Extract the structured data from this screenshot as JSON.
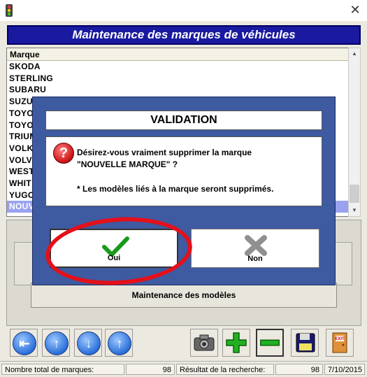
{
  "window": {
    "close_glyph": "✕"
  },
  "header": {
    "title": "Maintenance des marques de véhicules"
  },
  "list": {
    "column_header": "Marque",
    "rows": [
      "SKODA",
      "STERLING",
      "SUBARU",
      "SUZU",
      "TOYO",
      "TOYO",
      "TRIUM",
      "VOLK",
      "VOLV",
      "WEST",
      "WHIT",
      "YUGO",
      "NOUV"
    ],
    "selected_index": 12
  },
  "models_button": {
    "label": "Maintenance des modèles"
  },
  "dialog": {
    "title": "VALIDATION",
    "line1": "Désirez-vous vraiment supprimer la marque",
    "line2": "\"NOUVELLE MARQUE\" ?",
    "line3": "* Les modèles liés à la marque seront supprimés.",
    "question_glyph": "?",
    "yes_label": "Oui",
    "no_label": "Non"
  },
  "toolbar": {
    "nav_icons": [
      "first-record-icon",
      "previous-record-icon",
      "next-record-icon",
      "last-record-icon"
    ],
    "action_icons": [
      "camera-icon",
      "add-icon",
      "delete-icon",
      "save-icon",
      "exit-icon"
    ],
    "exit_text": "EXIT"
  },
  "status": {
    "total_label": "Nombre total de marques:",
    "total_value": "98",
    "search_label": "Résultat de la recherche:",
    "search_value": "98",
    "date": "7/10/2015"
  },
  "colors": {
    "banner": "#1a1aa0",
    "modal": "#3e5aa0",
    "selection": "#9aa2f0",
    "highlight_oval": "#e4101a"
  }
}
